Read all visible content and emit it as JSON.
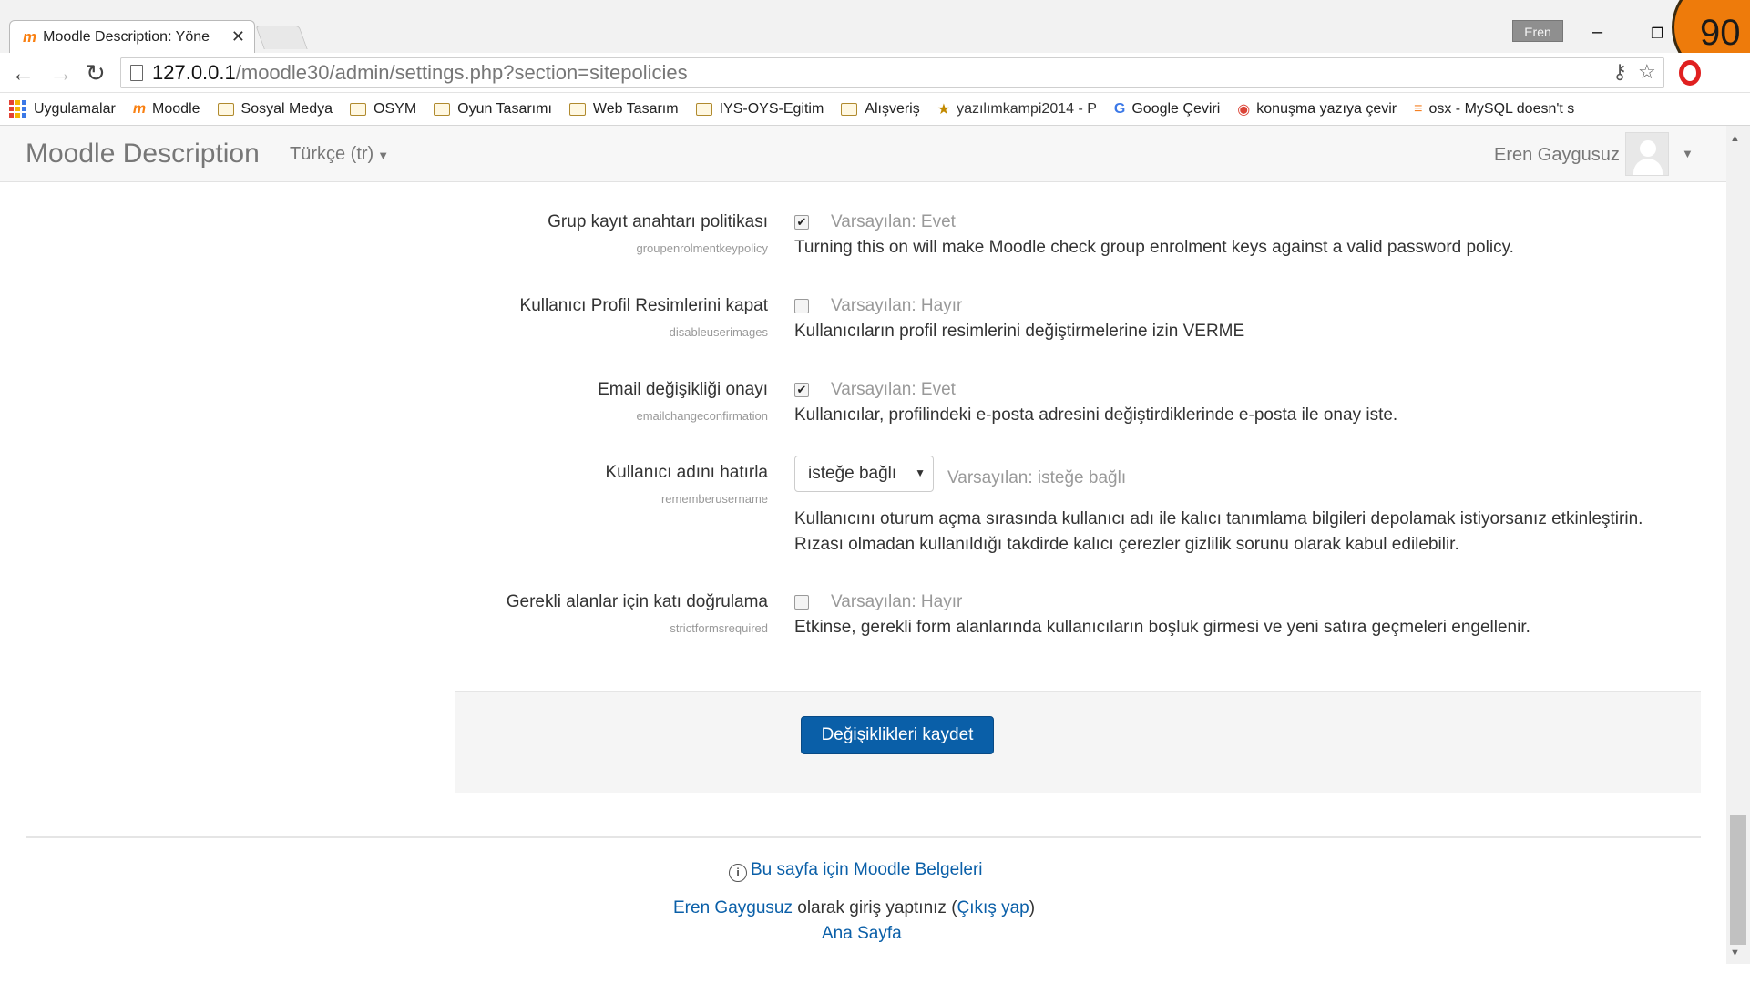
{
  "browser": {
    "tab_title": "Moodle Description: Yöne",
    "tab_favicon": "moodle-icon",
    "user_chip": "Eren",
    "url_host": "127.0.0.1",
    "url_path": "/moodle30/admin/settings.php?section=sitepolicies",
    "badge_number": "90",
    "bookmarks": [
      {
        "label": "Uygulamalar",
        "icon": "apps-grid-icon"
      },
      {
        "label": "Moodle",
        "icon": "moodle-icon"
      },
      {
        "label": "Sosyal Medya",
        "icon": "folder-icon"
      },
      {
        "label": "OSYM",
        "icon": "folder-icon"
      },
      {
        "label": "Oyun Tasarımı",
        "icon": "folder-icon"
      },
      {
        "label": "Web Tasarım",
        "icon": "folder-icon"
      },
      {
        "label": "IYS-OYS-Egitim",
        "icon": "folder-icon"
      },
      {
        "label": "Alışveriş",
        "icon": "folder-icon"
      },
      {
        "label": "yazılımkampi2014 - P",
        "icon": "site-icon"
      },
      {
        "label": "Google Çeviri",
        "icon": "translate-icon"
      },
      {
        "label": "konuşma yazıya çevir",
        "icon": "chrome-icon"
      },
      {
        "label": "osx - MySQL doesn't s",
        "icon": "stackoverflow-icon"
      }
    ]
  },
  "navbar": {
    "brand": "Moodle Description",
    "language": "Türkçe (tr)",
    "user_name": "Eren Gaygusuz"
  },
  "settings": [
    {
      "label": "Grup kayıt anahtarı politikası",
      "code": "groupenrolmentkeypolicy",
      "checked": true,
      "default": "Varsayılan: Evet",
      "description": "Turning this on will make Moodle check group enrolment keys against a valid password policy."
    },
    {
      "label": "Kullanıcı Profil Resimlerini kapat",
      "code": "disableuserimages",
      "checked": false,
      "default": "Varsayılan: Hayır",
      "description": "Kullanıcıların profil resimlerini değiştirmelerine izin VERME"
    },
    {
      "label": "Email değişikliği onayı",
      "code": "emailchangeconfirmation",
      "checked": true,
      "default": "Varsayılan: Evet",
      "description": "Kullanıcılar, profilindeki e-posta adresini değiştirdiklerinde e-posta ile onay iste."
    },
    {
      "label": "Kullanıcı adını hatırla",
      "code": "rememberusername",
      "select_value": "isteğe bağlı",
      "default": "Varsayılan: isteğe bağlı",
      "description_line1": "Kullanıcını oturum açma sırasında kullanıcı adı ile kalıcı tanımlama bilgileri depolamak istiyorsanız etkinleştirin.",
      "description_line2": "Rızası olmadan kullanıldığı takdirde kalıcı çerezler gizlilik sorunu olarak kabul edilebilir."
    },
    {
      "label": "Gerekli alanlar için katı doğrulama",
      "code": "strictformsrequired",
      "checked": false,
      "default": "Varsayılan: Hayır",
      "description": "Etkinse, gerekli form alanlarında kullanıcıların boşluk girmesi ve yeni satıra geçmeleri engellenir."
    }
  ],
  "actions": {
    "save_label": "Değişiklikleri kaydet"
  },
  "footer": {
    "help_link": "Bu sayfa için Moodle Belgeleri",
    "user_link": "Eren Gaygusuz",
    "logged_in_text": " olarak giriş yaptınız (",
    "logout_link": "Çıkış yap",
    "close_paren": ")",
    "home_link": "Ana Sayfa"
  },
  "colors": {
    "primary_button": "#0a5fa8",
    "link": "#0a5fa8",
    "badge": "#ee7b0b"
  }
}
